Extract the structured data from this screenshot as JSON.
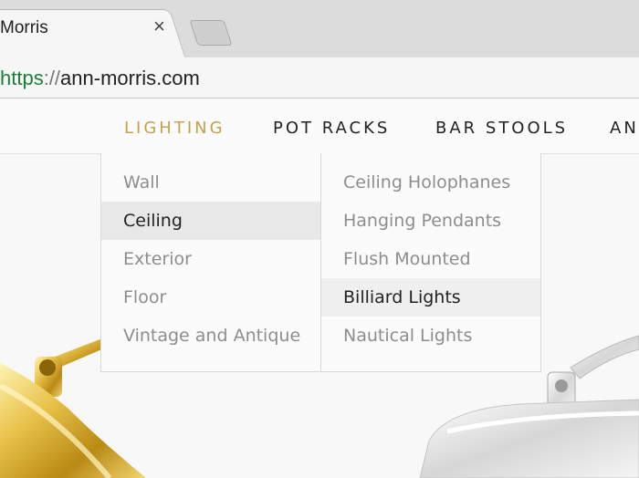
{
  "browser": {
    "tab_title": "Morris",
    "tab_close": "×",
    "url_scheme": "https",
    "url_separator": "://",
    "url_host": "ann-morris.com"
  },
  "nav": {
    "items": [
      {
        "label": "LIGHTING",
        "active": true
      },
      {
        "label": "POT RACKS"
      },
      {
        "label": "BAR STOOLS"
      },
      {
        "label": "AN"
      }
    ]
  },
  "dropdown": {
    "left_column": [
      {
        "label": "Wall"
      },
      {
        "label": "Ceiling",
        "highlighted": true
      },
      {
        "label": "Exterior"
      },
      {
        "label": "Floor"
      },
      {
        "label": "Vintage and Antique"
      }
    ],
    "right_column": [
      {
        "label": "Ceiling Holophanes"
      },
      {
        "label": "Hanging Pendants"
      },
      {
        "label": "Flush Mounted"
      },
      {
        "label": "Billiard Lights",
        "highlighted": true
      },
      {
        "label": "Nautical Lights"
      }
    ]
  },
  "colors": {
    "accent_gold": "#c5a14c",
    "url_green": "#188038",
    "brass": "#d9b23a",
    "nickel": "#e6e6e6"
  },
  "icons": {
    "tab_close": "close-icon",
    "new_tab": "new-tab-icon"
  }
}
